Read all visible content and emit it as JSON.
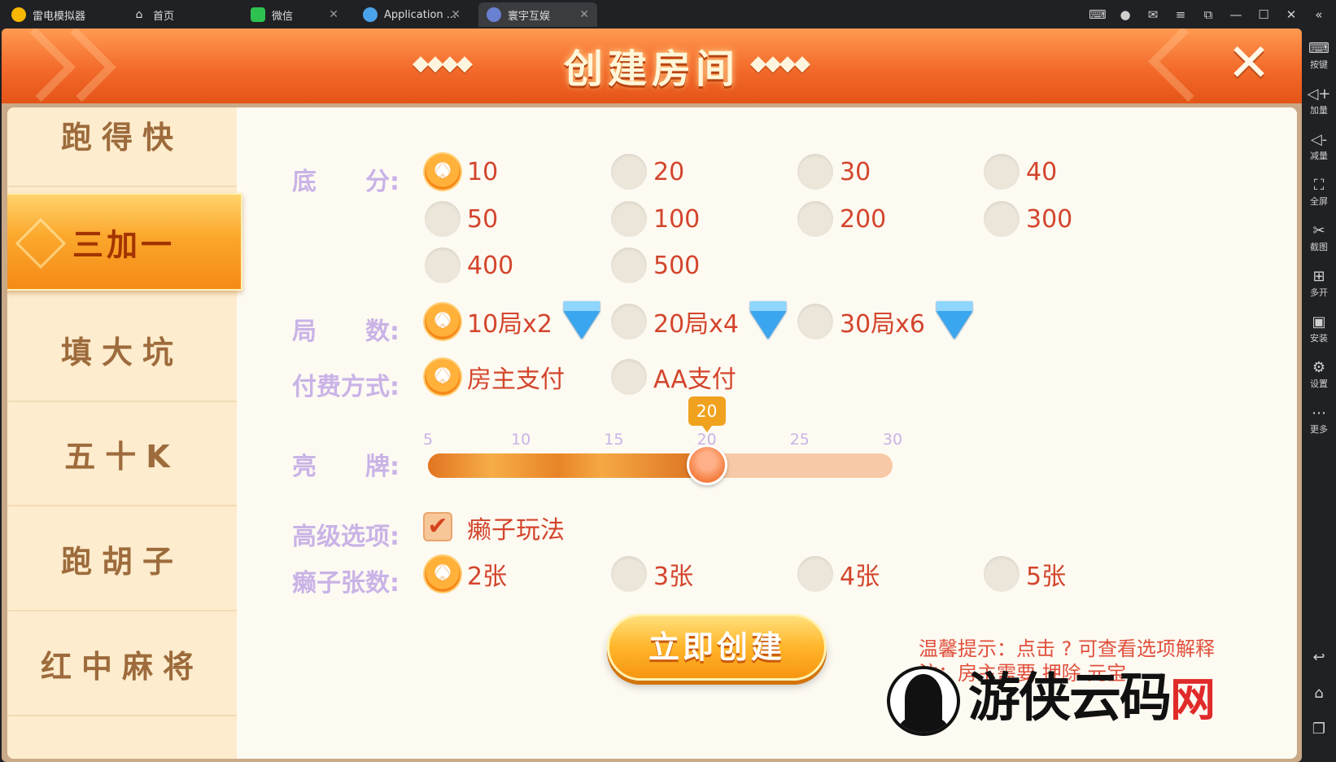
{
  "titlebar": {
    "tabs": [
      {
        "label": "雷电模拟器",
        "icon": "ldplayer-logo-icon"
      },
      {
        "label": "首页",
        "icon": "home-icon"
      },
      {
        "label": "微信",
        "icon": "wechat-icon"
      },
      {
        "label": "Application ...",
        "icon": "app-globe-icon"
      },
      {
        "label": "寰宇互娱",
        "icon": "game-app-icon"
      }
    ],
    "right_icons": [
      "gamepad-icon",
      "user-avatar-icon",
      "mail-icon",
      "menu-icon",
      "popout-icon",
      "minimize-icon",
      "maximize-icon",
      "close-window-icon",
      "collapse-icon"
    ]
  },
  "sidebar": {
    "items": [
      {
        "label": "按键",
        "icon": "keyboard-icon"
      },
      {
        "label": "加量",
        "icon": "volume-up-icon"
      },
      {
        "label": "减量",
        "icon": "volume-down-icon"
      },
      {
        "label": "全屏",
        "icon": "fullscreen-icon"
      },
      {
        "label": "截图",
        "icon": "scissors-icon"
      },
      {
        "label": "多开",
        "icon": "multi-instance-icon"
      },
      {
        "label": "安装",
        "icon": "apk-install-icon"
      },
      {
        "label": "设置",
        "icon": "settings-gear-icon"
      },
      {
        "label": "更多",
        "icon": "more-icon"
      }
    ],
    "bottom_icons": [
      "back-icon",
      "home-nav-icon",
      "recent-apps-icon"
    ]
  },
  "header": {
    "title": "创建房间",
    "deco_left": "◆◆◆◆",
    "deco_right": "◆◆◆◆",
    "close_label": "✕"
  },
  "menu": {
    "items": [
      "跑得快",
      "三加一",
      "填大坑",
      "五十K",
      "跑胡子",
      "红中麻将"
    ],
    "active": "三加一"
  },
  "options": {
    "base_score": {
      "label": "底　　分:",
      "values": [
        "10",
        "20",
        "30",
        "40",
        "50",
        "100",
        "200",
        "300",
        "400",
        "500"
      ],
      "selected": "10"
    },
    "rounds": {
      "label": "局　　数:",
      "values": [
        "10局x2",
        "20局x4",
        "30局x6"
      ],
      "selected": "10局x2"
    },
    "payment": {
      "label": "付费方式:",
      "values": [
        "房主支付",
        "AA支付"
      ],
      "selected": "房主支付"
    },
    "show_cards": {
      "label": "亮　　牌:",
      "ticks": [
        "5",
        "10",
        "15",
        "20",
        "25",
        "30"
      ],
      "min": 5,
      "max": 30,
      "value": 20,
      "value_text": "20"
    },
    "advanced": {
      "label": "高级选项:",
      "checkbox_label": "癞子玩法",
      "checked": true
    },
    "wild_count": {
      "label": "癞子张数:",
      "values": [
        "2张",
        "3张",
        "4张",
        "5张"
      ],
      "selected": "2张"
    }
  },
  "create_button": "立即创建",
  "tip_line1": "温馨提示：点击 ? 可查看选项解释",
  "tip_line2": "注：房主需要  押除  元宝",
  "watermark": {
    "text": "游侠云码",
    "suffix": "网"
  },
  "colors": {
    "accent_orange": "#f58818",
    "label_purple": "#c9b3e6",
    "option_red": "#d3452c",
    "menu_brown": "#9d6b3c"
  }
}
